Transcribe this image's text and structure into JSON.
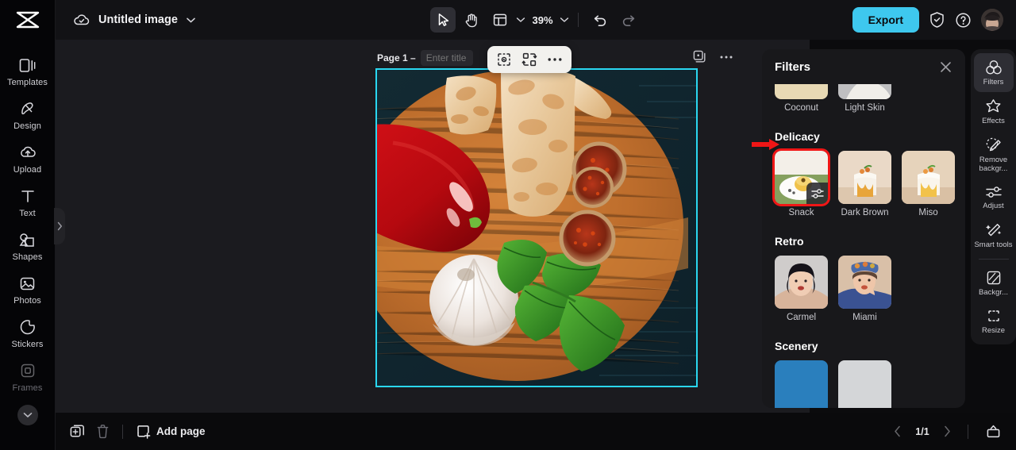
{
  "app": {
    "logo_icon": "capcut-logo-icon",
    "doc_title": "Untitled image",
    "cloud_icon": "cloud-saved-icon",
    "title_chevron_icon": "chevron-down-icon"
  },
  "toolbar": {
    "select_icon": "cursor-select-icon",
    "hand_icon": "hand-pan-icon",
    "layout_icon": "layout-grid-icon",
    "layout_chevron_icon": "chevron-down-icon",
    "zoom_value": "39%",
    "zoom_chevron_icon": "chevron-down-icon",
    "undo_icon": "undo-icon",
    "redo_icon": "redo-icon",
    "export_label": "Export",
    "shield_icon": "shield-check-icon",
    "help_icon": "help-circle-icon",
    "avatar_icon": "user-avatar"
  },
  "canvas": {
    "page_label": "Page 1 –",
    "title_placeholder": "Enter title",
    "title_value": "",
    "duplicate_page_icon": "duplicate-page-icon",
    "page_more_icon": "more-horizontal-icon",
    "float_tools": [
      {
        "name": "cutout-icon",
        "label": "Cutout"
      },
      {
        "name": "replace-media-icon",
        "label": "Replace"
      },
      {
        "name": "more-horizontal-icon",
        "label": "More"
      }
    ],
    "selection_color": "#2ad7f0",
    "image_alt": "red bell pepper, garlic, basil and flatbread on a wooden cutting board"
  },
  "filters_panel": {
    "title": "Filters",
    "close_icon": "close-icon",
    "partial_row": [
      {
        "name": "Coconut",
        "selected": false
      },
      {
        "name": "Light Skin",
        "selected": false
      }
    ],
    "sections": [
      {
        "title": "Delicacy",
        "annotated": true,
        "items": [
          {
            "name": "Snack",
            "selected": true,
            "adjust_icon": "sliders-icon"
          },
          {
            "name": "Dark Brown",
            "selected": false
          },
          {
            "name": "Miso",
            "selected": false
          }
        ]
      },
      {
        "title": "Retro",
        "annotated": false,
        "items": [
          {
            "name": "Carmel",
            "selected": false
          },
          {
            "name": "Miami",
            "selected": false
          }
        ]
      },
      {
        "title": "Scenery",
        "annotated": false,
        "items": [
          {
            "name": "",
            "selected": false
          },
          {
            "name": "",
            "selected": false
          }
        ]
      }
    ],
    "annotation_color": "#f01616",
    "selected_outline_color": "#f01616"
  },
  "right_rail": {
    "items": [
      {
        "label": "Filters",
        "icon": "filters-circles-icon",
        "active": true
      },
      {
        "label": "Effects",
        "icon": "effects-star-icon",
        "active": false
      },
      {
        "label": "Remove backgr...",
        "icon": "remove-background-wand-icon",
        "active": false
      },
      {
        "label": "Adjust",
        "icon": "adjust-sliders-icon",
        "active": false
      },
      {
        "label": "Smart tools",
        "icon": "smart-tools-wand-icon",
        "active": false
      },
      {
        "label": "Backgr...",
        "icon": "background-icon",
        "active": false
      },
      {
        "label": "Resize",
        "icon": "resize-icon",
        "active": false
      }
    ]
  },
  "left_rail": {
    "items": [
      {
        "label": "Templates",
        "icon": "templates-icon",
        "dim": false
      },
      {
        "label": "Design",
        "icon": "design-icon",
        "dim": false
      },
      {
        "label": "Upload",
        "icon": "upload-cloud-icon",
        "dim": false
      },
      {
        "label": "Text",
        "icon": "text-icon",
        "dim": false
      },
      {
        "label": "Shapes",
        "icon": "shapes-icon",
        "dim": false
      },
      {
        "label": "Photos",
        "icon": "photos-icon",
        "dim": false
      },
      {
        "label": "Stickers",
        "icon": "stickers-icon",
        "dim": false
      },
      {
        "label": "Frames",
        "icon": "frames-icon",
        "dim": true
      }
    ],
    "expand_icon": "chevron-down-icon",
    "panel_handle_icon": "chevron-right-icon"
  },
  "bottom_bar": {
    "duplicate_icon": "duplicate-icon",
    "delete_icon": "trash-icon",
    "add_page_icon": "add-page-icon",
    "add_page_label": "Add page",
    "prev_icon": "chevron-left-icon",
    "next_icon": "chevron-right-icon",
    "page_indicator": "1/1",
    "pages_panel_icon": "pages-panel-icon"
  }
}
